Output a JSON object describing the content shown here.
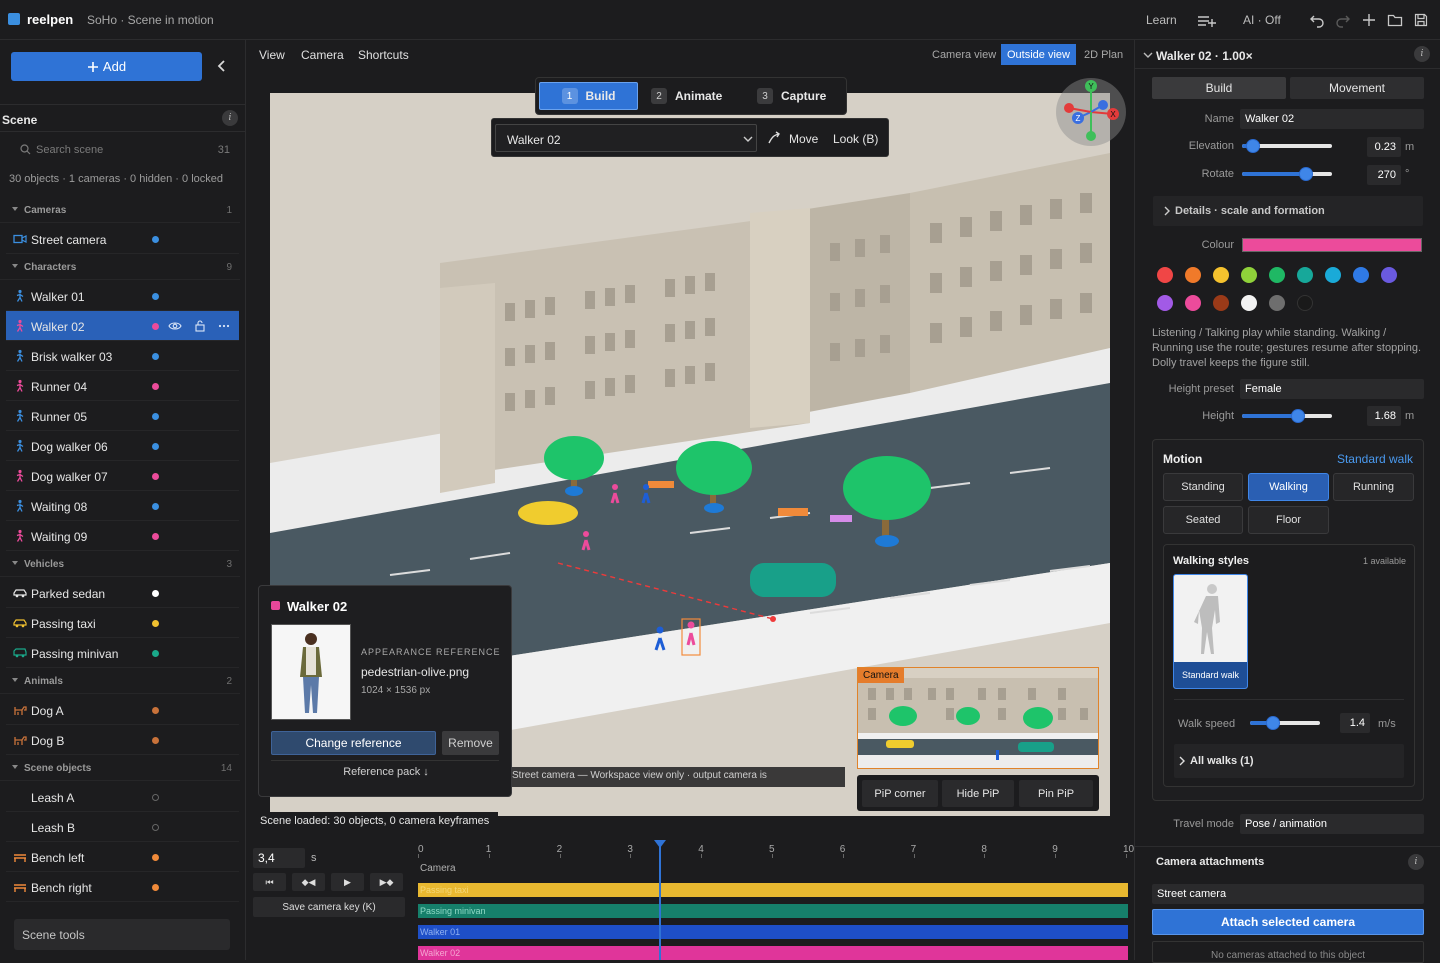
{
  "app": {
    "name": "reelpen",
    "project": "SoHo · Scene in motion"
  },
  "topbar": {
    "learn": "Learn",
    "ai": "AI · Off"
  },
  "left": {
    "add_label": "Add",
    "scene_title": "Scene",
    "search_placeholder": "Search scene",
    "search_count": "31",
    "summary": "30 objects · 1 cameras · 0 hidden · 0 locked",
    "groups": {
      "cameras": {
        "label": "Cameras",
        "count": "1"
      },
      "characters": {
        "label": "Characters",
        "count": "9"
      },
      "vehicles": {
        "label": "Vehicles",
        "count": "3"
      },
      "animals": {
        "label": "Animals",
        "count": "2"
      },
      "scene_objects": {
        "label": "Scene objects",
        "count": "14"
      }
    },
    "items": [
      {
        "label": "Street camera",
        "dot": "#3b8fe0",
        "icon": "camera-icon"
      },
      {
        "label": "Walker 01",
        "dot": "#3b8fe0",
        "icon": "person-icon"
      },
      {
        "label": "Walker 02",
        "dot": "#ec4b9b",
        "icon": "person-icon"
      },
      {
        "label": "Brisk walker 03",
        "dot": "#3b8fe0",
        "icon": "person-icon"
      },
      {
        "label": "Runner 04",
        "dot": "#ec4b9b",
        "icon": "person-icon"
      },
      {
        "label": "Runner 05",
        "dot": "#3b8fe0",
        "icon": "person-icon"
      },
      {
        "label": "Dog walker 06",
        "dot": "#3b8fe0",
        "icon": "person-icon"
      },
      {
        "label": "Dog walker 07",
        "dot": "#ec4b9b",
        "icon": "person-icon"
      },
      {
        "label": "Waiting 08",
        "dot": "#3b8fe0",
        "icon": "person-icon"
      },
      {
        "label": "Waiting 09",
        "dot": "#ec4b9b",
        "icon": "person-icon"
      },
      {
        "label": "Parked sedan",
        "dot": "#ffffff",
        "icon": "car-icon"
      },
      {
        "label": "Passing taxi",
        "dot": "#f0c030",
        "icon": "car-icon"
      },
      {
        "label": "Passing minivan",
        "dot": "#1aa98a",
        "icon": "car-icon"
      },
      {
        "label": "Dog A",
        "dot": "#c8723a",
        "icon": "dog-icon"
      },
      {
        "label": "Dog B",
        "dot": "#c8723a",
        "icon": "dog-icon"
      },
      {
        "label": "Leash A",
        "dot": "",
        "icon": "leash-icon"
      },
      {
        "label": "Leash B",
        "dot": "",
        "icon": "leash-icon"
      },
      {
        "label": "Bench left",
        "dot": "#f08a3a",
        "icon": "bench-icon"
      },
      {
        "label": "Bench right",
        "dot": "#f08a3a",
        "icon": "bench-icon"
      }
    ],
    "scene_tools": "Scene tools"
  },
  "center": {
    "menus": [
      "View",
      "Camera",
      "Shortcuts"
    ],
    "view_tabs": [
      "Camera view",
      "Outside view",
      "2D Plan"
    ],
    "active_view_tab": "Outside view",
    "steps": [
      {
        "n": "1",
        "label": "Build"
      },
      {
        "n": "2",
        "label": "Animate"
      },
      {
        "n": "3",
        "label": "Capture"
      }
    ],
    "active_step": "Build",
    "selected_object": "Walker 02",
    "move_label": "Move",
    "look_label": "Look (B)",
    "gizmo_axes": {
      "y": "Y",
      "x": "X",
      "z": "Z"
    },
    "reference_card": {
      "title": "Walker 02",
      "kicker": "APPEARANCE REFERENCE",
      "file": "pedestrian-olive.png",
      "dims": "1024 × 1536 px",
      "change": "Change reference",
      "remove": "Remove",
      "pack": "Reference pack ↓"
    },
    "pip": {
      "label": "Camera",
      "buttons": [
        "PiP corner",
        "Hide PiP",
        "Pin PiP"
      ]
    },
    "camera_notice": "Street camera — Workspace view only · output camera is",
    "status": "Scene loaded: 30 objects, 0 camera keyframes"
  },
  "timeline": {
    "time_value": "3,4",
    "time_unit": "s",
    "transport": [
      "⏮",
      "◆◀",
      "▶",
      "▶◆"
    ],
    "save_key": "Save camera key (K)",
    "ticks": [
      "0",
      "1",
      "2",
      "3",
      "4",
      "5",
      "6",
      "7",
      "8",
      "9",
      "10"
    ],
    "playhead_seconds": 3.4,
    "track_label": "Camera",
    "tracks": [
      {
        "label": "Passing taxi",
        "color": "#e8b830"
      },
      {
        "label": "Passing minivan",
        "color": "#16806b"
      },
      {
        "label": "Walker 01",
        "color": "#1e4fc8"
      },
      {
        "label": "Walker 02",
        "color": "#e0359a"
      }
    ]
  },
  "right": {
    "title": "Walker 02 · 1.00×",
    "tabs": [
      "Build",
      "Movement"
    ],
    "name_label": "Name",
    "name_value": "Walker 02",
    "elevation_label": "Elevation",
    "elevation_value": "0.23",
    "elevation_unit": "m",
    "elevation_fraction": 0.05,
    "rotate_label": "Rotate",
    "rotate_value": "270",
    "rotate_unit": "°",
    "rotate_fraction": 0.75,
    "details": "Details · scale and formation",
    "colour_label": "Colour",
    "colour_value": "#ec4b9b",
    "palette": [
      "#f04646",
      "#f07a2a",
      "#f5c22e",
      "#8fd13a",
      "#1fb864",
      "#17a89a",
      "#1aaad8",
      "#2f7ae6",
      "#6a5ae0",
      "#a25ae6",
      "#ec4b9b",
      "#9a3a18",
      "#f2f2f2",
      "#6e6e6e",
      "#1a1a1a"
    ],
    "help": "Listening / Talking play while standing. Walking / Running use the route; gestures resume after stopping. Dolly travel keeps the figure still.",
    "height_preset_label": "Height preset",
    "height_preset_value": "Female",
    "height_label": "Height",
    "height_value": "1.68",
    "height_unit": "m",
    "height_fraction": 0.65,
    "motion": {
      "title": "Motion",
      "current": "Standard walk",
      "options": [
        "Standing",
        "Walking",
        "Running",
        "Seated",
        "Floor"
      ],
      "active": "Walking",
      "styles_title": "Walking styles",
      "styles_count": "1 available",
      "style_card": "Standard walk",
      "walk_speed_label": "Walk speed",
      "walk_speed_value": "1.4",
      "walk_speed_unit": "m/s",
      "walk_speed_fraction": 0.28,
      "all_walks": "All walks (1)"
    },
    "travel_mode_label": "Travel mode",
    "travel_mode_value": "Pose / animation",
    "camera_attach_title": "Camera attachments",
    "camera_attach_value": "Street camera",
    "attach_button": "Attach selected camera",
    "no_cameras": "No cameras attached to this object"
  }
}
